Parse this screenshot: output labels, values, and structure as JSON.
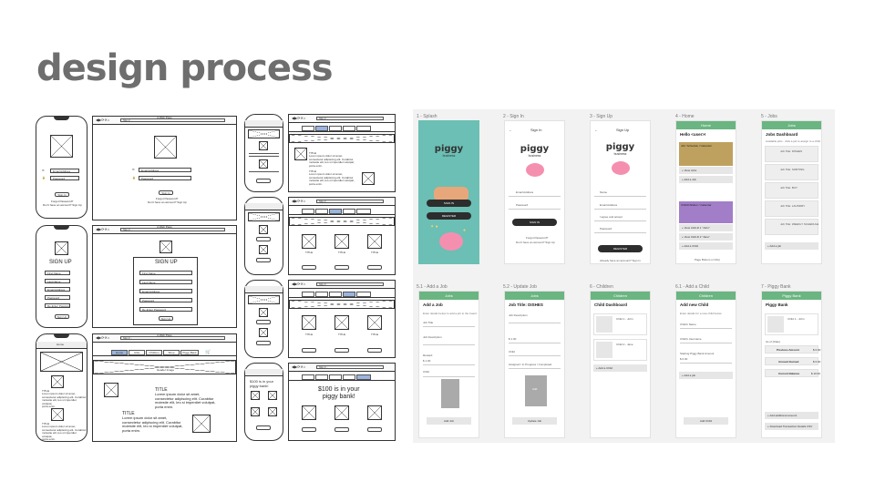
{
  "slide": {
    "title": "design process"
  },
  "wireframes": {
    "browser_title": "A Web Page",
    "url": "http://...",
    "signin": {
      "email": "Email Address",
      "password": "Password",
      "button": "Sign In",
      "forgot": "Forgot Password?",
      "signup_link": "Don't have an account? Sign Up"
    },
    "signup": {
      "title": "SIGN UP",
      "fields": [
        "First Name",
        "Last Name",
        "Email Address",
        "Password",
        "Re-Enter Password"
      ],
      "button": "Sign Up"
    },
    "home": {
      "nav": [
        "Home",
        "Jobs",
        "Children",
        "Shop",
        "Piggy Bank"
      ],
      "header_image": "Header Image",
      "item_title": "TITLE",
      "body": "Lorem ipsum dolor sit amet,\nconsectetur adipiscing elit. Curabitur\nmolestie elit, leo si imperdiet volutpat,\nporta enim."
    },
    "piggy": {
      "message": "$100 is in your\npiggy bank!"
    }
  },
  "prototype": {
    "labels": [
      "1 - Splash",
      "2 - Sign In",
      "3 - Sign Up",
      "4 - Home",
      "5 - Jobs",
      "5.1 - Add a Job",
      "5.2 - Update Job",
      "6 - Children",
      "6.1 - Add a Child",
      "7 - Piggy Bank"
    ],
    "logo": "piggy",
    "logo_sub": "business",
    "splash": {
      "signin": "SIGN IN",
      "register": "REGISTER"
    },
    "signin": {
      "title": "Sign In",
      "email": "Email Address",
      "password": "Password",
      "button": "SIGN IN",
      "forgot": "Forgot Password?",
      "no_account": "Don't have an account? Sign Up"
    },
    "signup": {
      "title": "Sign Up",
      "fields": [
        "Name",
        "Email Address",
        "I agree and accept",
        "Password"
      ],
      "button": "REGISTER",
      "have_account": "Already have an account? Sign In"
    },
    "home": {
      "bar": "Home",
      "greeting": "Hello <user>!",
      "cards": [
        "Job: Schedule / Calendar",
        "Child/Children / Calendar"
      ],
      "links": [
        "+ View Jobs",
        "+ Add a Job",
        "+ View CHILD 1 \"John\"",
        "+ View CHILD 2 \"Jane\"",
        "+ Add a Child"
      ],
      "footer": "Page Bottom or FAQ"
    },
    "jobs": {
      "bar": "Jobs",
      "title": "Jobs Dashboard",
      "subtitle": "Available jobs - click a job to assign to a child",
      "items": [
        "Job Title: DISHES",
        "Job Title: SORTING",
        "Job Title: BUY",
        "Job Title: LAUNDRY",
        "Job Title: WEEKLY SCHEDULE"
      ],
      "add": "+ Add a job"
    },
    "addjob": {
      "bar": "Jobs",
      "title": "Add a Job",
      "subtitle": "Enter details below to add a job to the board",
      "fields": [
        "Job Title",
        "Job Description",
        "Reward",
        "$ 1.00",
        "Child"
      ],
      "button": "Add Job"
    },
    "updatejob": {
      "bar": "Jobs",
      "title": "Job Title: DISHES",
      "fields": [
        "Job Description",
        "$ 1.00",
        "Child",
        "Assigned / In Progress / Completed"
      ],
      "button": "Update Job",
      "photo": "Add"
    },
    "children": {
      "bar": "Children",
      "title": "Child Dashboard",
      "items": [
        "Child 1 - John",
        "Child 2 - Jane"
      ],
      "add": "+ Add a Child"
    },
    "addchild": {
      "bar": "Children",
      "title": "Add new Child",
      "subtitle": "Enter details for a new child below",
      "fields": [
        "Child's Name",
        "Child's Username",
        "Starting Piggy Bank Amount",
        "$ 0.00"
      ],
      "add": "+ Add a job",
      "button": "Add Child"
    },
    "piggybank": {
      "bar": "Piggy Bank",
      "title": "Piggy Bank",
      "child": "Child 1 - John",
      "asof": "As of (Date)",
      "rows": [
        {
          "label": "Previous Amount",
          "value": "$ 0.00"
        },
        {
          "label": "Amount Earned",
          "value": "$ 0.00"
        },
        {
          "label": "Current Balance",
          "value": "$ 10.00"
        }
      ],
      "links": [
        "+ Add additional amount",
        "+ Download Transaction Details CSV"
      ]
    }
  },
  "colors": {
    "green_bar": "#6ab581",
    "teal": "#6bbfb4",
    "pink": "#f58fb0",
    "gold": "#bfa15f",
    "purple": "#a27ec8",
    "nav_blue": "#9bb4e0"
  }
}
